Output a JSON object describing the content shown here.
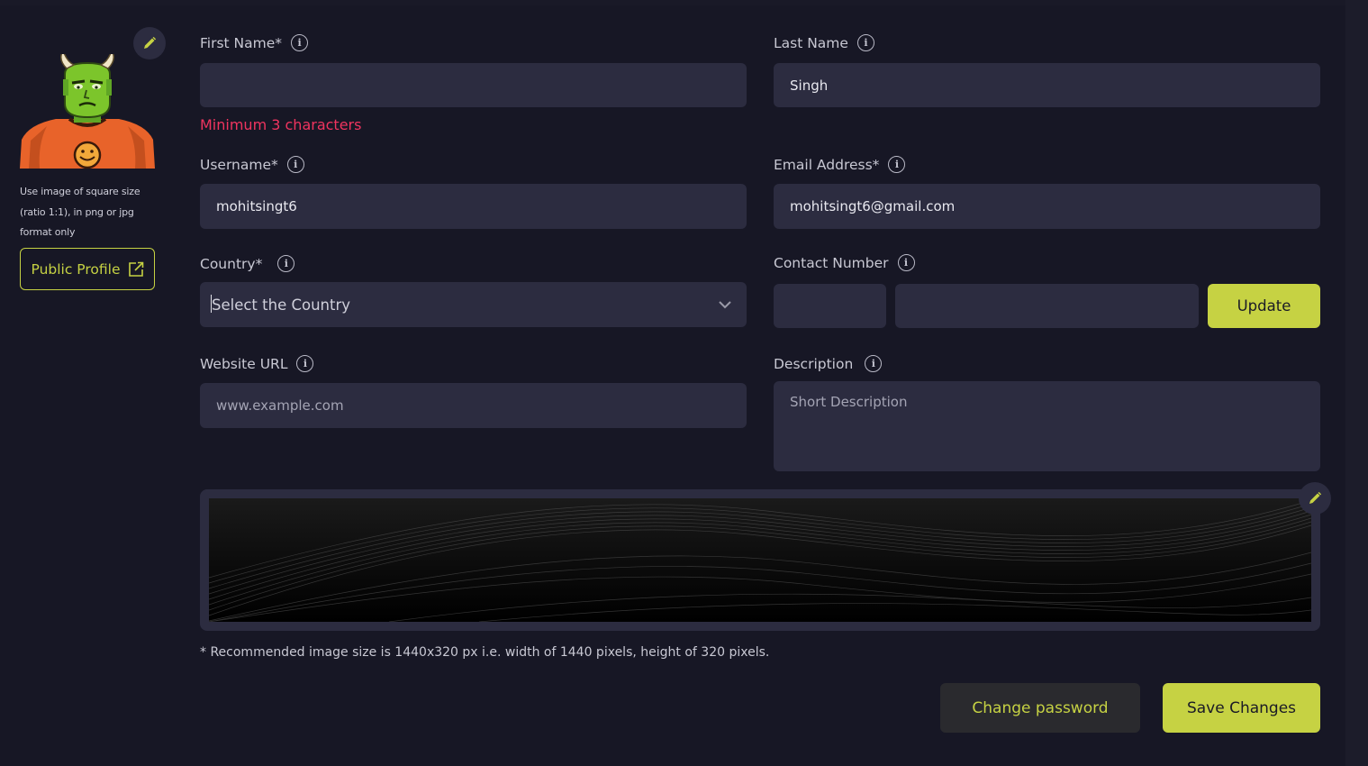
{
  "profile": {
    "image_hint": "Use image of square size (ratio 1:1), in png or jpg format only",
    "public_profile_label": "Public Profile"
  },
  "form": {
    "first_name": {
      "label": "First Name*",
      "value": "",
      "error": "Minimum 3 characters"
    },
    "last_name": {
      "label": "Last Name",
      "value": "Singh"
    },
    "username": {
      "label": "Username*",
      "value": "mohitsingt6"
    },
    "email": {
      "label": "Email Address*",
      "value": "mohitsingt6@gmail.com"
    },
    "country": {
      "label": "Country*",
      "placeholder": "Select the Country"
    },
    "contact": {
      "label": "Contact Number",
      "code_value": "",
      "number_value": "",
      "update_label": "Update"
    },
    "website": {
      "label": "Website URL",
      "placeholder": "www.example.com"
    },
    "description": {
      "label": "Description",
      "placeholder": "Short Description"
    }
  },
  "banner": {
    "note": "* Recommended image size is 1440x320 px i.e. width of 1440 pixels, height of 320 pixels."
  },
  "actions": {
    "change_password": "Change password",
    "save_changes": "Save Changes"
  },
  "icons": {
    "edit": "pencil-icon",
    "info": "info-icon",
    "external": "external-link-icon",
    "dropdown": "chevron-down-icon"
  },
  "colors": {
    "background": "#171725",
    "field": "#2c2c40",
    "accent": "#c6d243",
    "error": "#f0345f"
  }
}
